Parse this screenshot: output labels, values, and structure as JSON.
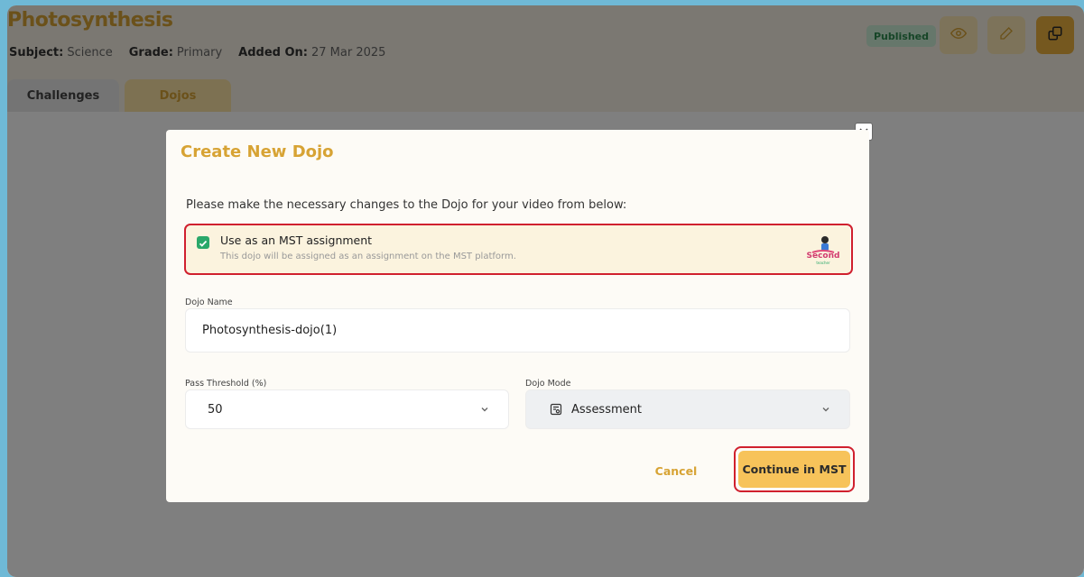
{
  "page": {
    "title": "Photosynthesis",
    "meta": [
      {
        "label": "Subject:",
        "value": "Science"
      },
      {
        "label": "Grade:",
        "value": "Primary"
      },
      {
        "label": "Added On:",
        "value": "27 Mar 2025"
      }
    ],
    "status_badge": "Published",
    "tabs": [
      "Challenges",
      "Dojos"
    ]
  },
  "modal": {
    "title": "Create New Dojo",
    "description": "Please make the necessary changes to the Dojo for your video from below:",
    "mst": {
      "checked": true,
      "title": "Use as an MST assignment",
      "subtitle": "This dojo will be assigned as an assignment on the MST platform.",
      "logo_text": "Second",
      "logo_text_small": "teacher"
    },
    "dojo_name": {
      "label": "Dojo Name",
      "value": "Photosynthesis-dojo(1)"
    },
    "pass_threshold": {
      "label": "Pass Threshold (%)",
      "value": "50"
    },
    "dojo_mode": {
      "label": "Dojo Mode",
      "value": "Assessment"
    },
    "cancel_label": "Cancel",
    "continue_label": "Continue in MST"
  },
  "colors": {
    "accent": "#d7a334",
    "button_primary": "#f7c35a",
    "highlight": "#d0202e",
    "badge_bg": "#cdeed7",
    "badge_text": "#2c8a4f"
  },
  "icons": {
    "preview": "eye-icon",
    "edit": "pencil-icon",
    "copy": "copy-icon",
    "close": "close-icon",
    "chevron": "chevron-down-icon",
    "mode": "assessment-icon",
    "check": "check-icon"
  }
}
